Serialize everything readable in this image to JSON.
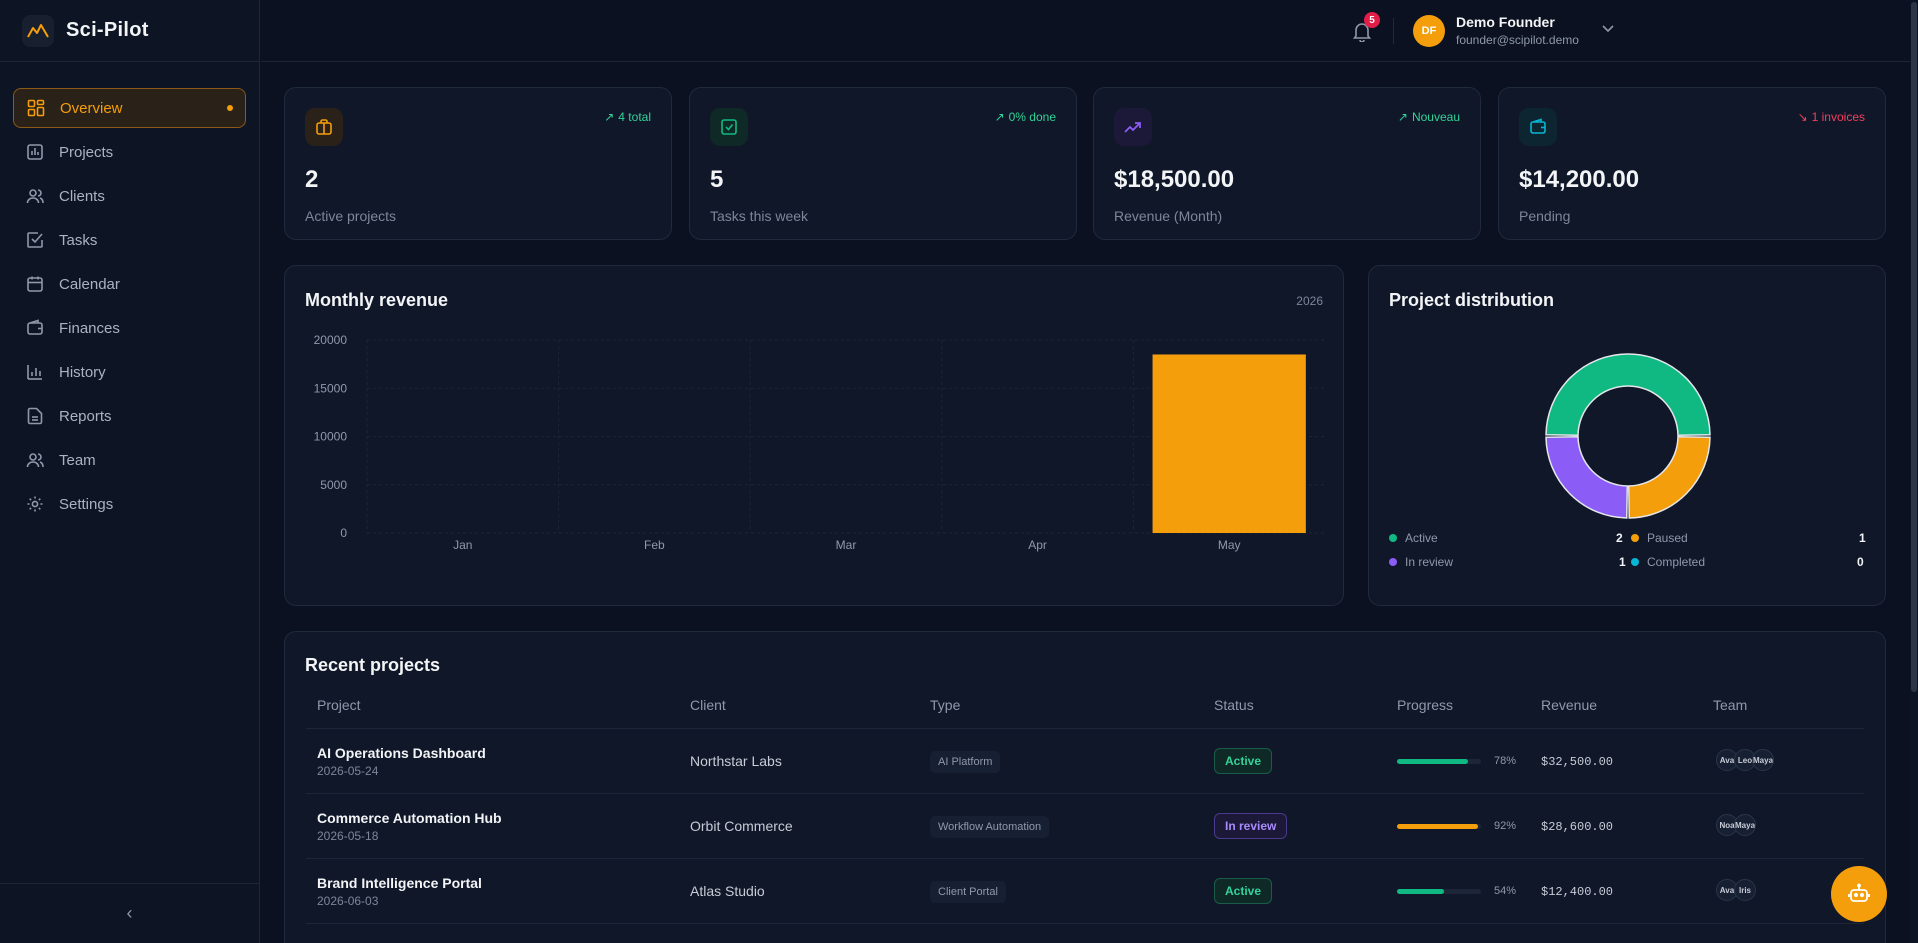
{
  "app": {
    "name": "Sci-Pilot"
  },
  "sidebar": {
    "items": [
      {
        "label": "Overview",
        "icon": "layout-grid-icon"
      },
      {
        "label": "Projects",
        "icon": "folder-chart-icon"
      },
      {
        "label": "Clients",
        "icon": "users-icon"
      },
      {
        "label": "Tasks",
        "icon": "check-square-icon"
      },
      {
        "label": "Calendar",
        "icon": "calendar-icon"
      },
      {
        "label": "Finances",
        "icon": "wallet-icon"
      },
      {
        "label": "History",
        "icon": "bar-chart-icon"
      },
      {
        "label": "Reports",
        "icon": "file-text-icon"
      },
      {
        "label": "Team",
        "icon": "users-icon"
      },
      {
        "label": "Settings",
        "icon": "gear-icon"
      }
    ],
    "active_index": 0,
    "collapse_glyph": "‹"
  },
  "header": {
    "notification_count": "5",
    "user": {
      "initials": "DF",
      "name": "Demo Founder",
      "email": "founder@scipilot.demo"
    }
  },
  "stats": [
    {
      "value": "2",
      "label": "Active projects",
      "badge": "4 total",
      "badge_color": "#34d399",
      "icon": "briefcase-icon",
      "accent": "#f59e0b"
    },
    {
      "value": "5",
      "label": "Tasks this week",
      "badge": "0% done",
      "badge_color": "#34d399",
      "icon": "check-square-icon",
      "accent": "#10b981"
    },
    {
      "value": "$18,500.00",
      "label": "Revenue (Month)",
      "badge": "Nouveau",
      "badge_color": "#34d399",
      "icon": "trending-up-icon",
      "accent": "#8b5cf6"
    },
    {
      "value": "$14,200.00",
      "label": "Pending",
      "badge": "1 invoices",
      "badge_color": "#f43f5e",
      "icon": "wallet-icon",
      "accent": "#06b6d4"
    }
  ],
  "revenue_panel": {
    "title": "Monthly revenue",
    "year": "2026"
  },
  "distribution_panel": {
    "title": "Project distribution",
    "legend": [
      {
        "label": "Active",
        "value": "2",
        "color": "#10b981"
      },
      {
        "label": "Paused",
        "value": "1",
        "color": "#f59e0b"
      },
      {
        "label": "In review",
        "value": "1",
        "color": "#8b5cf6"
      },
      {
        "label": "Completed",
        "value": "0",
        "color": "#06b6d4"
      }
    ]
  },
  "chart_data": [
    {
      "type": "bar",
      "title": "Monthly revenue",
      "categories": [
        "Jan",
        "Feb",
        "Mar",
        "Apr",
        "May"
      ],
      "values": [
        0,
        0,
        0,
        0,
        18500
      ],
      "yticks": [
        "0",
        "5000",
        "10000",
        "15000",
        "20000"
      ],
      "ylim": [
        0,
        20000
      ],
      "color": "#f59e0b",
      "grid": true
    },
    {
      "type": "pie",
      "title": "Project distribution",
      "categories": [
        "Active",
        "Paused",
        "In review",
        "Completed"
      ],
      "values": [
        2,
        1,
        1,
        0
      ],
      "colors": [
        "#10b981",
        "#f59e0b",
        "#8b5cf6",
        "#06b6d4"
      ],
      "donut": true
    }
  ],
  "projects": {
    "title": "Recent projects",
    "columns": [
      "Project",
      "Client",
      "Type",
      "Status",
      "Progress",
      "Revenue",
      "Team"
    ],
    "rows": [
      {
        "name": "AI Operations Dashboard",
        "date": "2026-05-24",
        "client": "Northstar Labs",
        "type": "AI Platform",
        "status": "Active",
        "progress": 78,
        "progress_label": "78%",
        "progress_color": "#10b981",
        "revenue": "$32,500.00",
        "team": [
          "Ava",
          "Leo",
          "Maya"
        ]
      },
      {
        "name": "Commerce Automation Hub",
        "date": "2026-05-18",
        "client": "Orbit Commerce",
        "type": "Workflow Automation",
        "status": "In review",
        "progress": 92,
        "progress_label": "92%",
        "progress_color": "#f59e0b",
        "revenue": "$28,600.00",
        "team": [
          "Noa",
          "Maya"
        ]
      },
      {
        "name": "Brand Intelligence Portal",
        "date": "2026-06-03",
        "client": "Atlas Studio",
        "type": "Client Portal",
        "status": "Active",
        "progress": 54,
        "progress_label": "54%",
        "progress_color": "#10b981",
        "revenue": "$12,400.00",
        "team": [
          "Ava",
          "Iris"
        ]
      }
    ]
  }
}
